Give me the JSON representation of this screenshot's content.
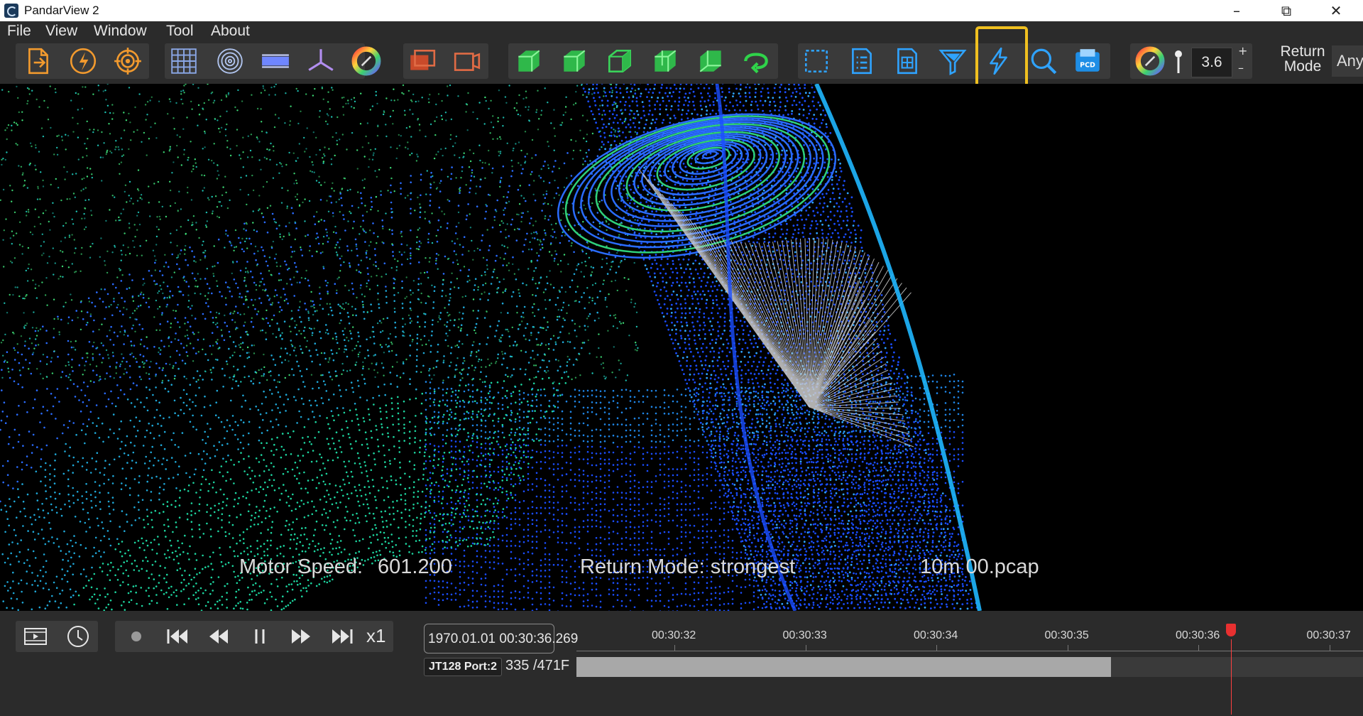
{
  "window": {
    "title": "PandarView 2",
    "controls": [
      "–",
      "⧉",
      "✕"
    ]
  },
  "menu": [
    "File",
    "View",
    "Window",
    "Tool",
    "About"
  ],
  "toolbar": {
    "point_size": "3.6",
    "spin_up": "+",
    "spin_down": "–",
    "return_mode_label_1": "Return",
    "return_mode_label_2": "Mode",
    "return_mode_value": "Any",
    "highlighted_tool": "lightning-outline-icon",
    "icons": [
      "open-file-icon",
      "connect-lidar-icon",
      "target-icon",
      "grid-icon",
      "rings-icon",
      "ground-plane-icon",
      "axes-icon",
      "color-wheel-icon",
      "camera-frame-icon",
      "camera-frame-alt-icon",
      "view-cube-front-icon",
      "view-cube-side-icon",
      "view-cube-top-icon",
      "view-cube-left-icon",
      "view-cube-back-icon",
      "rotate-view-icon",
      "selection-box-icon",
      "list-icon",
      "table-icon",
      "filter-icon",
      "lightning-outline-icon",
      "search-icon",
      "pcd-export-icon",
      "color-palette-icon",
      "point-size-icon"
    ]
  },
  "viewport": {
    "motor_speed_label": "Motor Speed:",
    "motor_speed_value": "601.200",
    "return_mode_text": "Return Mode: strongest",
    "file_name": "10m 00.pcap"
  },
  "playback": {
    "speed": "x1",
    "timestamp": "1970.01.01 00:30:36.269",
    "ticks": [
      "00:30:32",
      "00:30:33",
      "00:30:34",
      "00:30:35",
      "00:30:36",
      "00:30:37"
    ],
    "port": "JT128 Port:2",
    "frame_current": "335",
    "frame_total": "/471F",
    "progress_fraction": 0.68
  },
  "colors": {
    "accent_highlight": "#f0c020",
    "cursor": "#e83030",
    "points_green": "#3fe37a",
    "points_blue": "#1a4dff",
    "rays": "#cfcfcf"
  }
}
